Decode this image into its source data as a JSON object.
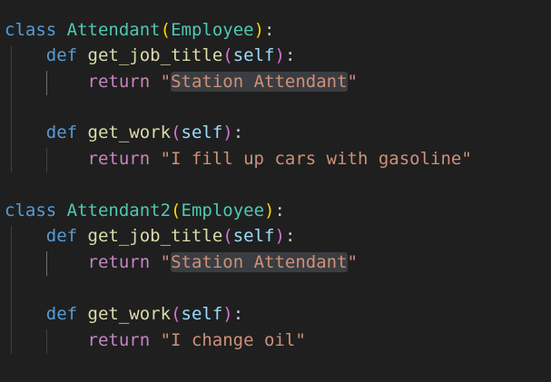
{
  "editor": {
    "language": "python",
    "theme": "dark",
    "colors": {
      "background": "#1f1f1f",
      "keyword": "#569cd6",
      "control_keyword": "#c586c0",
      "class_name": "#4ec9b0",
      "function_name": "#dcdcaa",
      "parameter": "#9cdcfe",
      "string": "#ce9178",
      "bracket_level1": "#ffd700",
      "bracket_level2": "#da70d6"
    },
    "highlighted_selection": "Station Attendant",
    "lines": [
      {
        "indent": "",
        "tokens": [
          "class",
          " ",
          "Attendant",
          "(",
          "Employee",
          ")",
          ":"
        ]
      },
      {
        "indent": "    ",
        "tokens": [
          "def",
          " ",
          "get_job_title",
          "(",
          "self",
          ")",
          ":"
        ]
      },
      {
        "indent": "        ",
        "tokens": [
          "return",
          " ",
          "\"",
          "Station Attendant",
          "\""
        ]
      },
      {
        "indent": "",
        "tokens": []
      },
      {
        "indent": "    ",
        "tokens": [
          "def",
          " ",
          "get_work",
          "(",
          "self",
          ")",
          ":"
        ]
      },
      {
        "indent": "        ",
        "tokens": [
          "return",
          " ",
          "\"I fill up cars with gasoline\""
        ]
      },
      {
        "indent": "",
        "tokens": []
      },
      {
        "indent": "",
        "tokens": [
          "class",
          " ",
          "Attendant2",
          "(",
          "Employee",
          ")",
          ":"
        ]
      },
      {
        "indent": "    ",
        "tokens": [
          "def",
          " ",
          "get_job_title",
          "(",
          "self",
          ")",
          ":"
        ]
      },
      {
        "indent": "        ",
        "tokens": [
          "return",
          " ",
          "\"",
          "Station Attendant",
          "\""
        ]
      },
      {
        "indent": "",
        "tokens": []
      },
      {
        "indent": "    ",
        "tokens": [
          "def",
          " ",
          "get_work",
          "(",
          "self",
          ")",
          ":"
        ]
      },
      {
        "indent": "        ",
        "tokens": [
          "return",
          " ",
          "\"I change oil\""
        ]
      }
    ]
  }
}
